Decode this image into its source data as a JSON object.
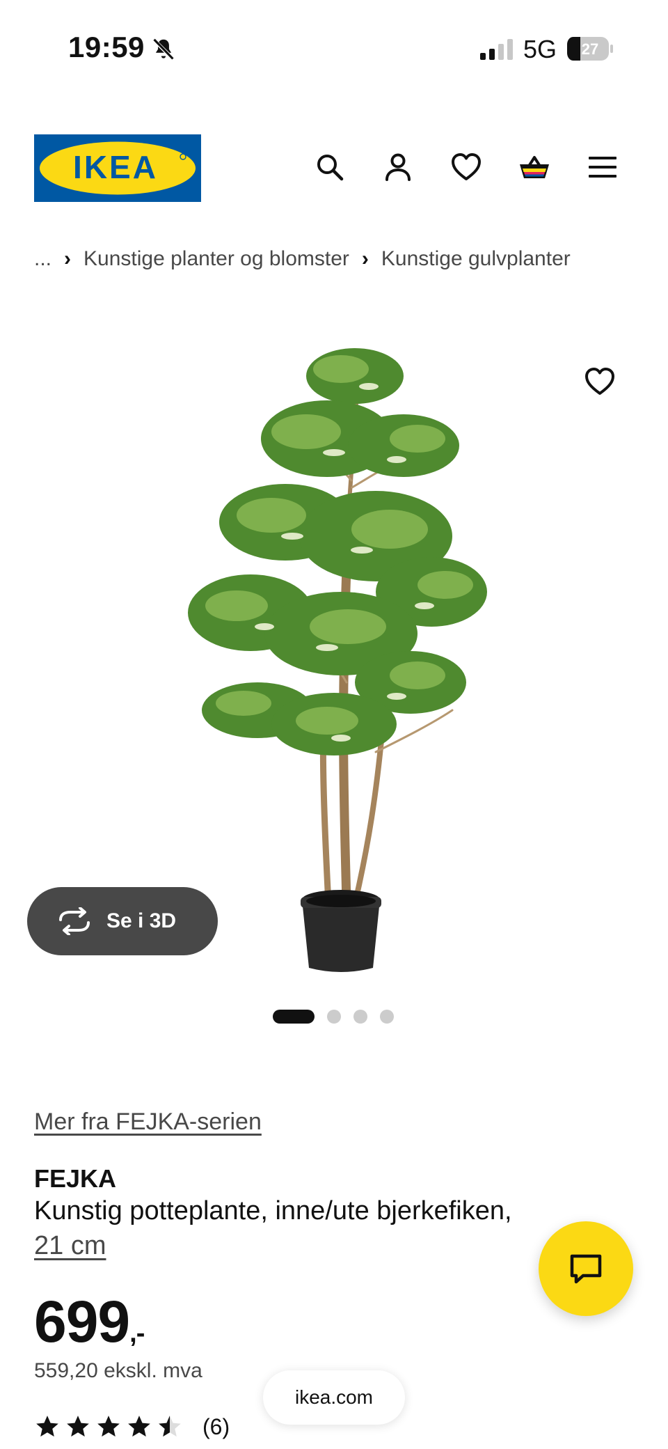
{
  "status_bar": {
    "time": "19:59",
    "network": "5G",
    "battery": "27",
    "mute_icon": "bell-slash-icon",
    "signal_icon": "cellular-signal-icon"
  },
  "header": {
    "logo_text": "IKEA",
    "icons": [
      "search-icon",
      "user-icon",
      "heart-icon",
      "cart-icon",
      "menu-icon"
    ],
    "colors": {
      "logo_blue": "#0058a3",
      "logo_yellow": "#fbd914"
    }
  },
  "breadcrumb": {
    "ellipsis": "...",
    "items": [
      "Kunstige planter og blomster",
      "Kunstige gulvplanter"
    ]
  },
  "gallery": {
    "view3d_label": "Se i 3D",
    "slide_count": 4,
    "active_slide": 1
  },
  "product": {
    "series_link": "Mer fra FEJKA-serien",
    "name": "FEJKA",
    "description": "Kunstig potteplante, inne/ute bjerkefiken,",
    "size": "21 cm",
    "price": "699",
    "price_suffix": ",-",
    "price_excl_vat": "559,20 ekskl. mva",
    "rating": 4.5,
    "review_count": "(6)"
  },
  "browser": {
    "url": "ikea.com"
  },
  "colors": {
    "accent_yellow": "#fbd914",
    "dark_button": "#484848",
    "text": "#111111",
    "muted_text": "#484848"
  }
}
